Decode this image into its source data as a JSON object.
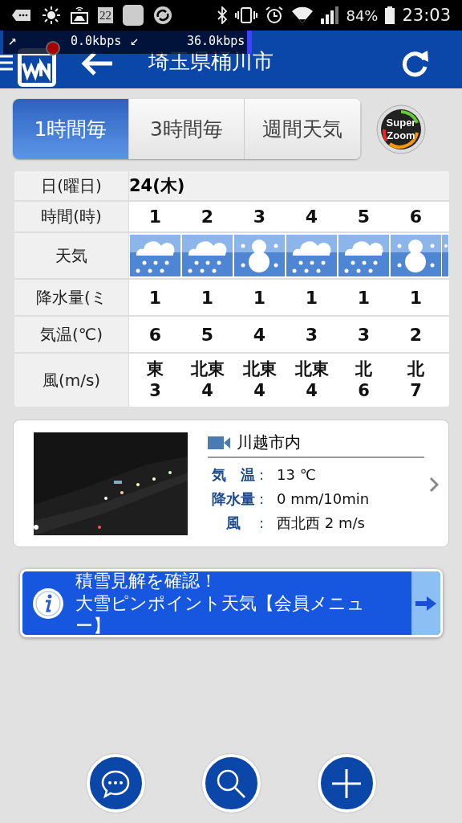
{
  "status_bar": {
    "date_badge": "22",
    "battery_percent": "84%",
    "time": "23:03"
  },
  "network_overlay": {
    "up_arrow": "↗",
    "up_rate": "0.0kbps",
    "down_arrow": "↙",
    "down_rate": "36.0kbps"
  },
  "header": {
    "title": "埼玉県桶川市"
  },
  "tabs": [
    {
      "label": "1時間毎",
      "selected": true
    },
    {
      "label": "3時間毎",
      "selected": false
    },
    {
      "label": "週間天気",
      "selected": false
    }
  ],
  "super_zoom": {
    "line1": "Super",
    "line2": "Zoom"
  },
  "table": {
    "labels": [
      "日(曜日)",
      "時間(時)",
      "天気",
      "降水量(ミ",
      "気温(℃)",
      "風(m/s)"
    ],
    "date": "24(木)",
    "hours": [
      {
        "hour": "1",
        "kind": "snow",
        "precip": "1",
        "temp": "6",
        "wind_dir": "東",
        "wind_speed": "3"
      },
      {
        "hour": "2",
        "kind": "snow",
        "precip": "1",
        "temp": "5",
        "wind_dir": "北東",
        "wind_speed": "4"
      },
      {
        "hour": "3",
        "kind": "snowman",
        "precip": "1",
        "temp": "4",
        "wind_dir": "北東",
        "wind_speed": "4"
      },
      {
        "hour": "4",
        "kind": "snow",
        "precip": "1",
        "temp": "3",
        "wind_dir": "北東",
        "wind_speed": "4"
      },
      {
        "hour": "5",
        "kind": "snow",
        "precip": "1",
        "temp": "3",
        "wind_dir": "北",
        "wind_speed": "6"
      },
      {
        "hour": "6",
        "kind": "snowman",
        "precip": "1",
        "temp": "2",
        "wind_dir": "北",
        "wind_speed": "7"
      }
    ],
    "cut_off_column": {
      "kind": "snowman"
    }
  },
  "camera_card": {
    "title": "川越市内",
    "rows": [
      {
        "label": "気　温",
        "colon": ":",
        "value": "13 ℃"
      },
      {
        "label": "降水量",
        "colon": ":",
        "value": "0 mm/10min"
      },
      {
        "label": "風",
        "colon": ":",
        "value": "西北西 2 m/s"
      }
    ]
  },
  "banner": {
    "line1": "積雪見解を確認！",
    "line2": "大雪ピンポイント天気【会員メニュー】"
  },
  "bottom_buttons": [
    {
      "kind": "chat"
    },
    {
      "kind": "search"
    },
    {
      "kind": "add"
    }
  ]
}
